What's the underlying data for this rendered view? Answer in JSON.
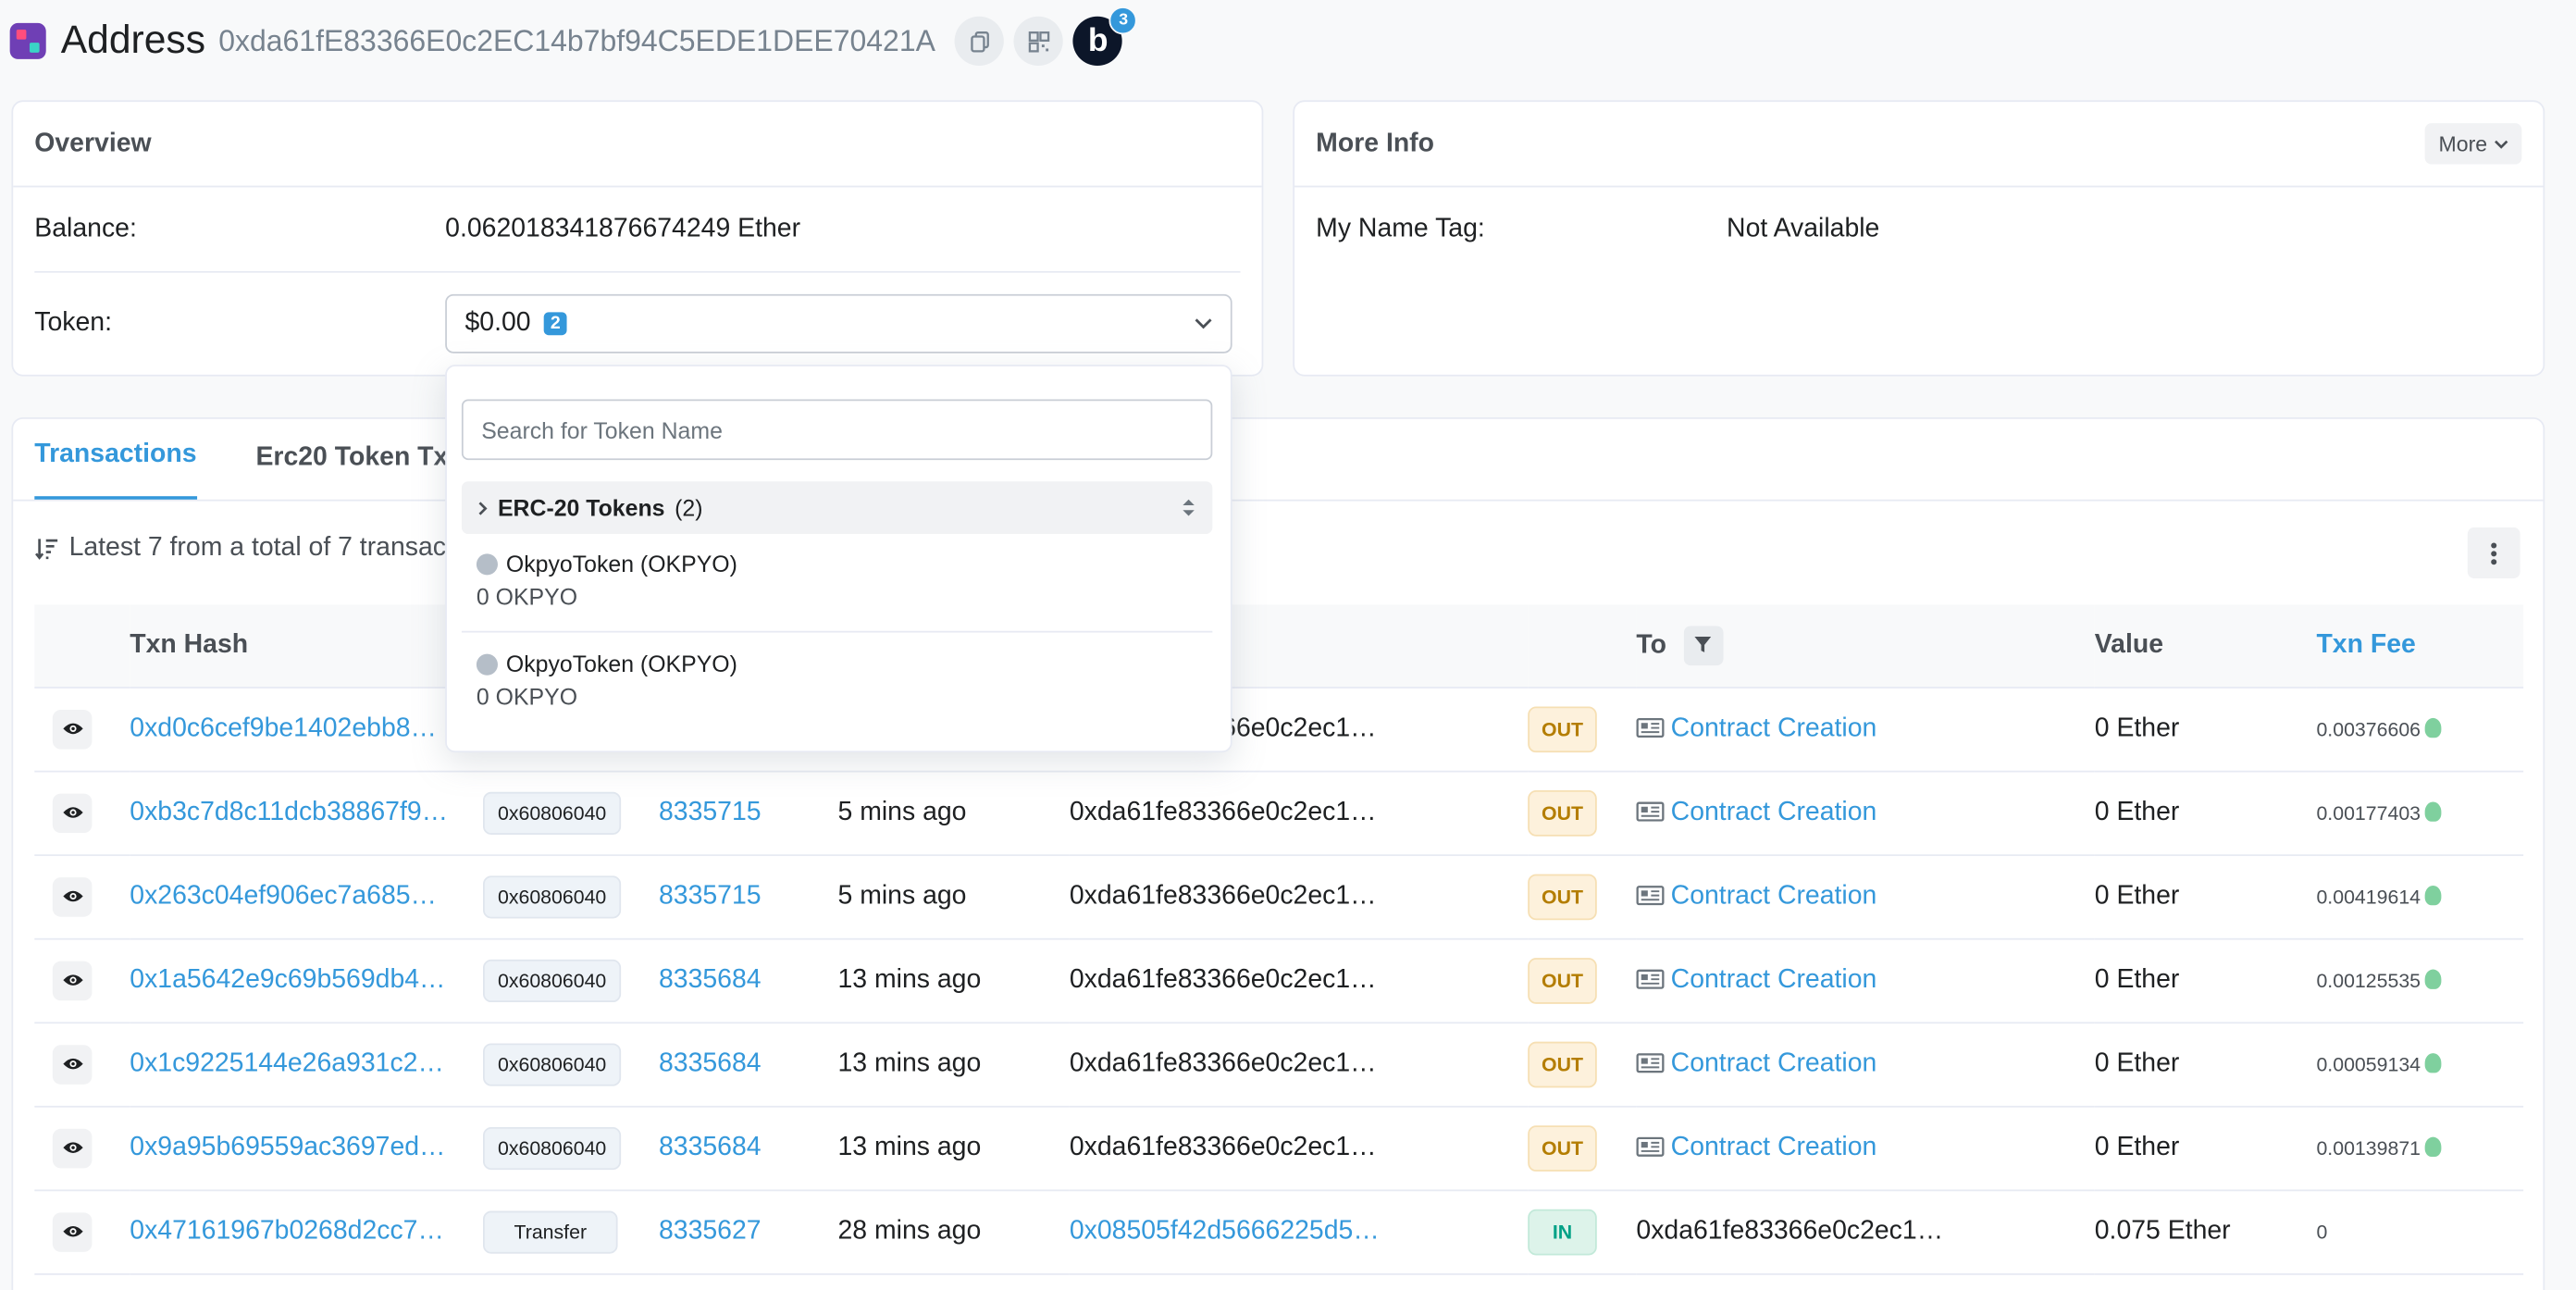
{
  "header": {
    "title": "Address",
    "address": "0xda61fE83366E0c2EC14b7bf94C5EDE1DEE70421A",
    "blockscan_letter": "b",
    "blockscan_count": "3"
  },
  "overview": {
    "title": "Overview",
    "balance_label": "Balance:",
    "balance_value": "0.062018341876674249 Ether",
    "token_label": "Token:",
    "token_value": "$0.00",
    "token_count": "2"
  },
  "more_info": {
    "title": "More Info",
    "more_button": "More",
    "name_tag_label": "My Name Tag:",
    "name_tag_value": "Not Available"
  },
  "token_dropdown": {
    "search_placeholder": "Search for Token Name",
    "group_title": "ERC-20 Tokens",
    "group_count": "(2)",
    "items": [
      {
        "name": "OkpyoToken (OKPYO)",
        "amount": "0 OKPYO"
      },
      {
        "name": "OkpyoToken (OKPYO)",
        "amount": "0 OKPYO"
      }
    ]
  },
  "tabs": [
    "Transactions",
    "Erc20 Token Txns"
  ],
  "summary": "Latest 7 from a total of 7 transactions",
  "table": {
    "headers": {
      "txn_hash": "Txn Hash",
      "to": "To",
      "value": "Value",
      "txn_fee": "Txn Fee"
    },
    "rows": [
      {
        "hash": "0xd0c6cef9be1402ebb8…",
        "method": "",
        "block": "",
        "age": "",
        "from": "0xda61fe83366e0c2ec1…",
        "dir": "OUT",
        "to": "Contract Creation",
        "value": "0 Ether",
        "fee": "0.00376606"
      },
      {
        "hash": "0xb3c7d8c11dcb38867f9…",
        "method": "0x60806040",
        "block": "8335715",
        "age": "5 mins ago",
        "from": "0xda61fe83366e0c2ec1…",
        "dir": "OUT",
        "to": "Contract Creation",
        "value": "0 Ether",
        "fee": "0.00177403"
      },
      {
        "hash": "0x263c04ef906ec7a685…",
        "method": "0x60806040",
        "block": "8335715",
        "age": "5 mins ago",
        "from": "0xda61fe83366e0c2ec1…",
        "dir": "OUT",
        "to": "Contract Creation",
        "value": "0 Ether",
        "fee": "0.00419614"
      },
      {
        "hash": "0x1a5642e9c69b569db4…",
        "method": "0x60806040",
        "block": "8335684",
        "age": "13 mins ago",
        "from": "0xda61fe83366e0c2ec1…",
        "dir": "OUT",
        "to": "Contract Creation",
        "value": "0 Ether",
        "fee": "0.00125535"
      },
      {
        "hash": "0x1c9225144e26a931c2…",
        "method": "0x60806040",
        "block": "8335684",
        "age": "13 mins ago",
        "from": "0xda61fe83366e0c2ec1…",
        "dir": "OUT",
        "to": "Contract Creation",
        "value": "0 Ether",
        "fee": "0.00059134"
      },
      {
        "hash": "0x9a95b69559ac3697ed…",
        "method": "0x60806040",
        "block": "8335684",
        "age": "13 mins ago",
        "from": "0xda61fe83366e0c2ec1…",
        "dir": "OUT",
        "to": "Contract Creation",
        "value": "0 Ether",
        "fee": "0.00139871"
      },
      {
        "hash": "0x47161967b0268d2cc7…",
        "method": "Transfer",
        "block": "8335627",
        "age": "28 mins ago",
        "from": "0x08505f42d5666225d5…",
        "dir": "IN",
        "to": "0xda61fe83366e0c2ec1…",
        "value": "0.075 Ether",
        "fee": "0"
      }
    ]
  }
}
